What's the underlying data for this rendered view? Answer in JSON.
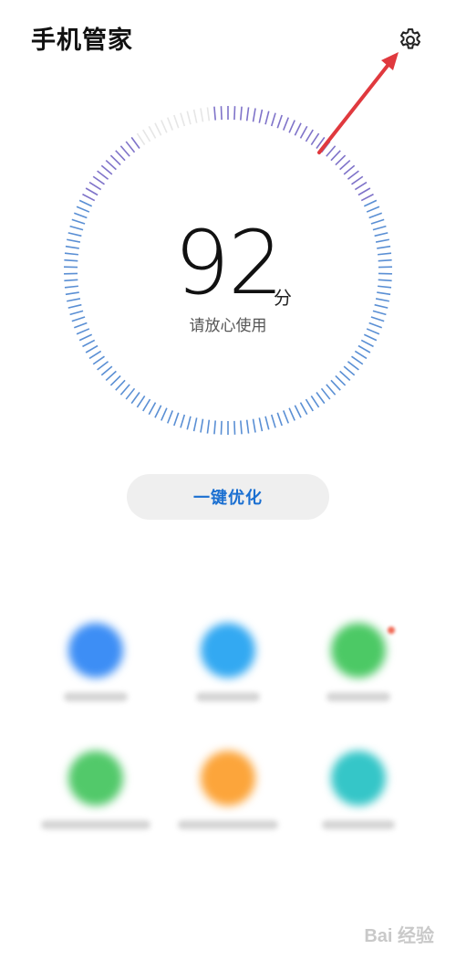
{
  "header": {
    "title": "手机管家",
    "settings_icon": "gear-icon"
  },
  "score": {
    "value": "92",
    "unit": "分",
    "status": "请放心使用",
    "fraction": 0.92
  },
  "actions": {
    "optimize_label": "一键优化"
  },
  "shortcuts": [
    {
      "icon": "blurred-app-icon",
      "color": "#3d8ef5",
      "has_badge": false
    },
    {
      "icon": "blurred-app-icon",
      "color": "#33a9f2",
      "has_badge": false
    },
    {
      "icon": "blurred-app-icon",
      "color": "#4cc965",
      "has_badge": true
    },
    {
      "icon": "blurred-app-icon",
      "color": "#52c96a",
      "has_badge": false
    },
    {
      "icon": "blurred-app-icon",
      "color": "#fca53b",
      "has_badge": false
    },
    {
      "icon": "blurred-app-icon",
      "color": "#35c6c8",
      "has_badge": false
    }
  ],
  "annotation": {
    "arrow_color": "#e0393e"
  },
  "watermark": {
    "text": "Bai 经验"
  }
}
